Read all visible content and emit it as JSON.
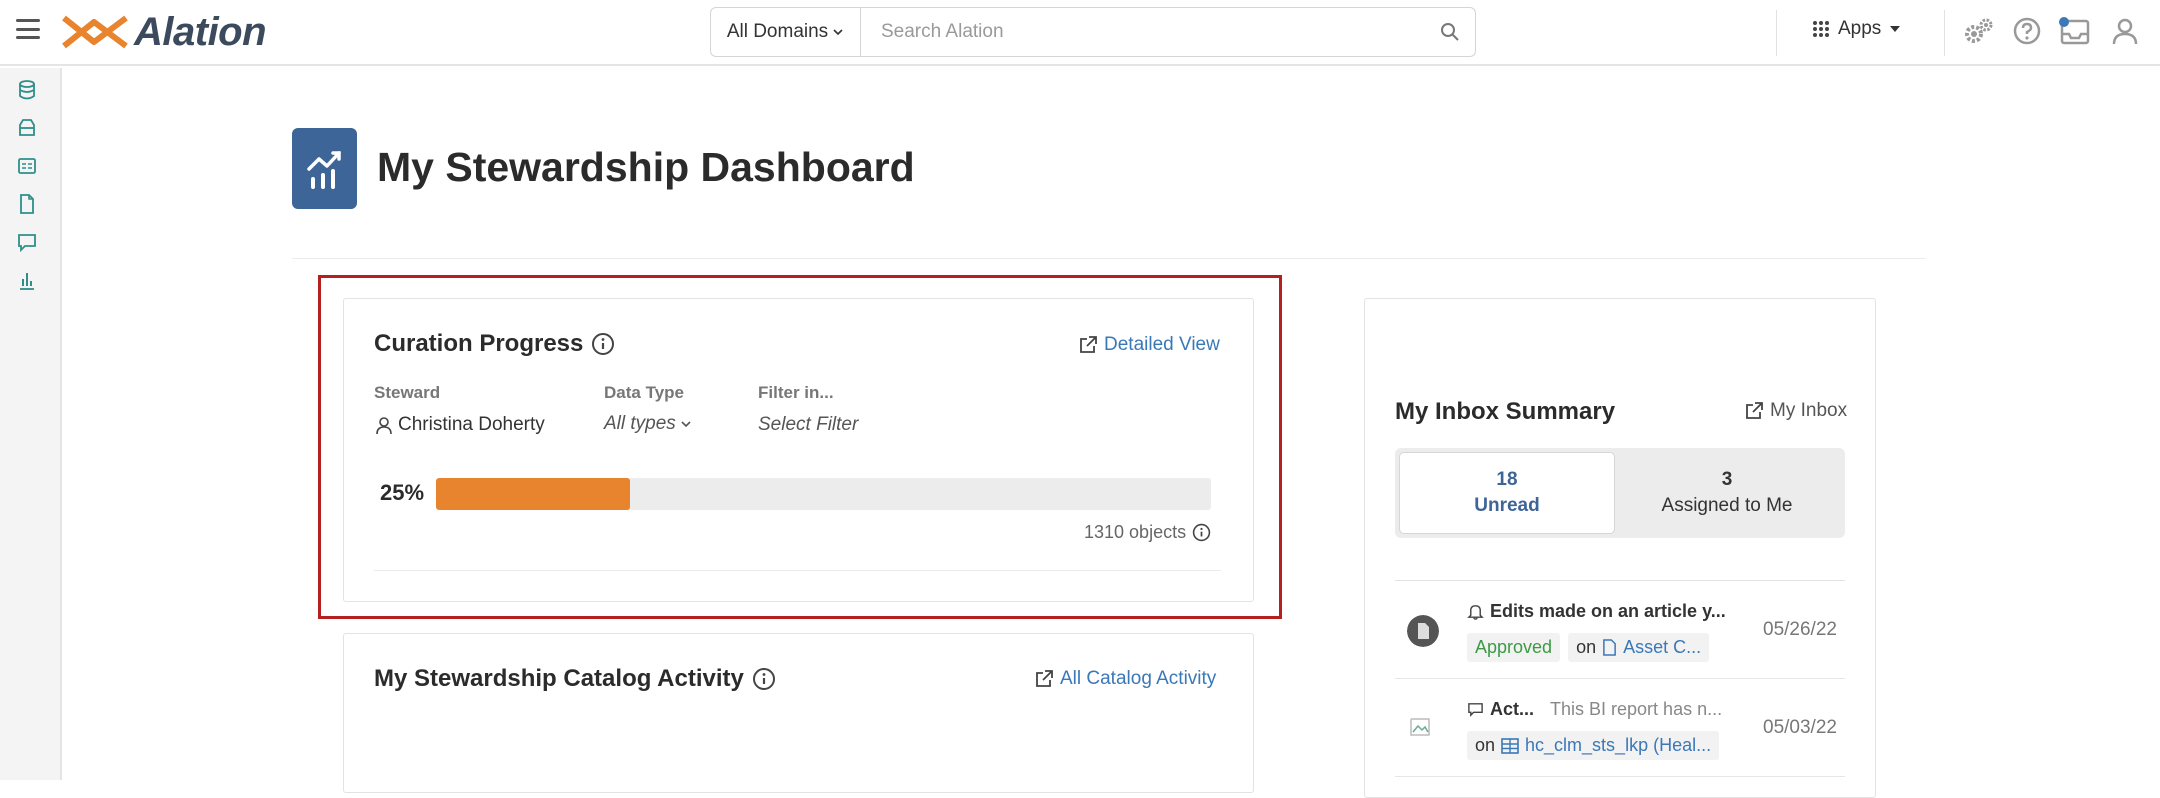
{
  "topbar": {
    "logo_text": "Alation",
    "domain_select": "All Domains",
    "search_placeholder": "Search Alation",
    "apps_label": "Apps"
  },
  "page": {
    "title": "My Stewardship Dashboard"
  },
  "curation": {
    "title": "Curation Progress",
    "detailed_view": "Detailed View",
    "steward_label": "Steward",
    "steward_value": "Christina Doherty",
    "datatype_label": "Data Type",
    "datatype_value": "All types",
    "filter_label": "Filter in...",
    "filter_value": "Select Filter",
    "percent_text": "25%",
    "progress": 0.25,
    "objects": "1310 objects"
  },
  "activity": {
    "title": "My Stewardship Catalog Activity",
    "link": "All Catalog Activity"
  },
  "inbox": {
    "title": "My Inbox Summary",
    "link": "My Inbox",
    "tabs": [
      {
        "count": "18",
        "label": "Unread"
      },
      {
        "count": "3",
        "label": "Assigned to Me"
      }
    ],
    "rows": [
      {
        "title": "Edits made on an article y...",
        "badge": "Approved",
        "on": "on",
        "target": "Asset C...",
        "date": "05/26/22"
      },
      {
        "title": "Act...",
        "snippet": "This BI report has n...",
        "on": "on",
        "target": "hc_clm_sts_lkp (Heal...",
        "date": "05/03/22"
      }
    ]
  },
  "colors": {
    "accent_blue": "#3e6597",
    "progress_orange": "#e8832e",
    "highlight_red": "#b5201e",
    "link_blue": "#3a78b8",
    "nav_teal": "#2e8f8a"
  }
}
